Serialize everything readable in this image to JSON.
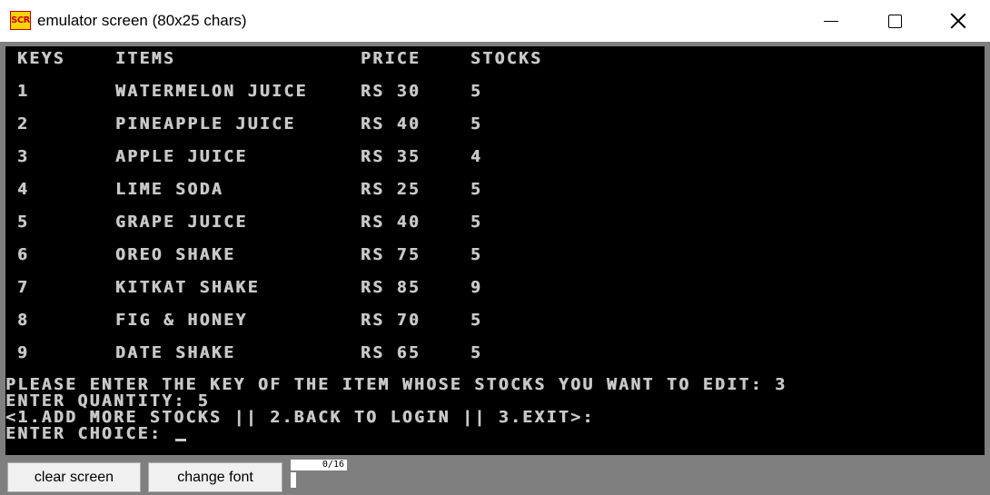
{
  "window": {
    "icon_text": "SCR",
    "title": "emulator screen (80x25 chars)"
  },
  "table": {
    "headers": [
      "KEYS",
      "ITEMS",
      "PRICE",
      "STOCKS"
    ],
    "rows": [
      [
        "1",
        "WATERMELON JUICE",
        "RS 30",
        "5"
      ],
      [
        "2",
        "PINEAPPLE JUICE",
        "RS 40",
        "5"
      ],
      [
        "3",
        "APPLE JUICE",
        "RS 35",
        "4"
      ],
      [
        "4",
        "LIME SODA",
        "RS 25",
        "5"
      ],
      [
        "5",
        "GRAPE JUICE",
        "RS 40",
        "5"
      ],
      [
        "6",
        "OREO SHAKE",
        "RS 75",
        "5"
      ],
      [
        "7",
        "KITKAT SHAKE",
        "RS 85",
        "9"
      ],
      [
        "8",
        "FIG & HONEY",
        "RS 70",
        "5"
      ],
      [
        "9",
        "DATE SHAKE",
        "RS 65",
        "5"
      ]
    ]
  },
  "prompts": {
    "line1": "PLEASE ENTER THE KEY OF THE ITEM WHOSE STOCKS YOU WANT TO EDIT: 3",
    "line2": "ENTER QUANTITY: 5",
    "line3": "<1.ADD MORE STOCKS || 2.BACK TO LOGIN || 3.EXIT>:",
    "line4": "ENTER CHOICE: "
  },
  "toolbar": {
    "clear_label": "clear screen",
    "font_label": "change font",
    "counter": "0/16"
  },
  "colors": {
    "screen_bg": "#000000",
    "screen_text": "#c8c8c8",
    "frame": "#7f7f7f",
    "icon_bg": "#f5d600",
    "icon_text": "#d00000"
  }
}
